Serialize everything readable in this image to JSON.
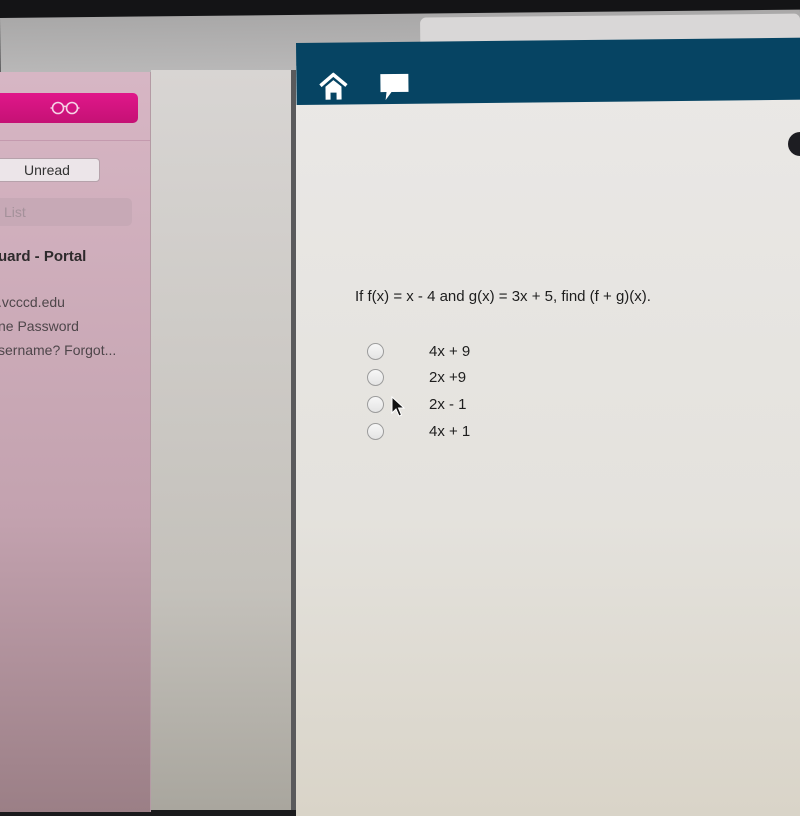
{
  "browser": {
    "address_bar_value": "",
    "lock_icon": "lock-icon"
  },
  "sidebar": {
    "glasses_icon": "reading-list-glasses-icon",
    "unread_label": "Unread",
    "search_placeholder": "List",
    "item": {
      "title": "uard - Portal",
      "lines": [
        ".vcccd.edu",
        "ne Password",
        "sername? Forgot..."
      ]
    },
    "colors": {
      "accent": "#d4147f",
      "background": "#d3b3c1"
    }
  },
  "quiz": {
    "header_icons": [
      "home-icon",
      "chat-icon"
    ],
    "header_color": "#064463",
    "question": "If f(x) = x - 4 and g(x) = 3x + 5, find (f + g)(x).",
    "options": [
      {
        "label": "4x + 9",
        "selected": false
      },
      {
        "label": "2x +9",
        "selected": false
      },
      {
        "label": "2x - 1",
        "selected": false
      },
      {
        "label": "4x + 1",
        "selected": false
      }
    ]
  }
}
